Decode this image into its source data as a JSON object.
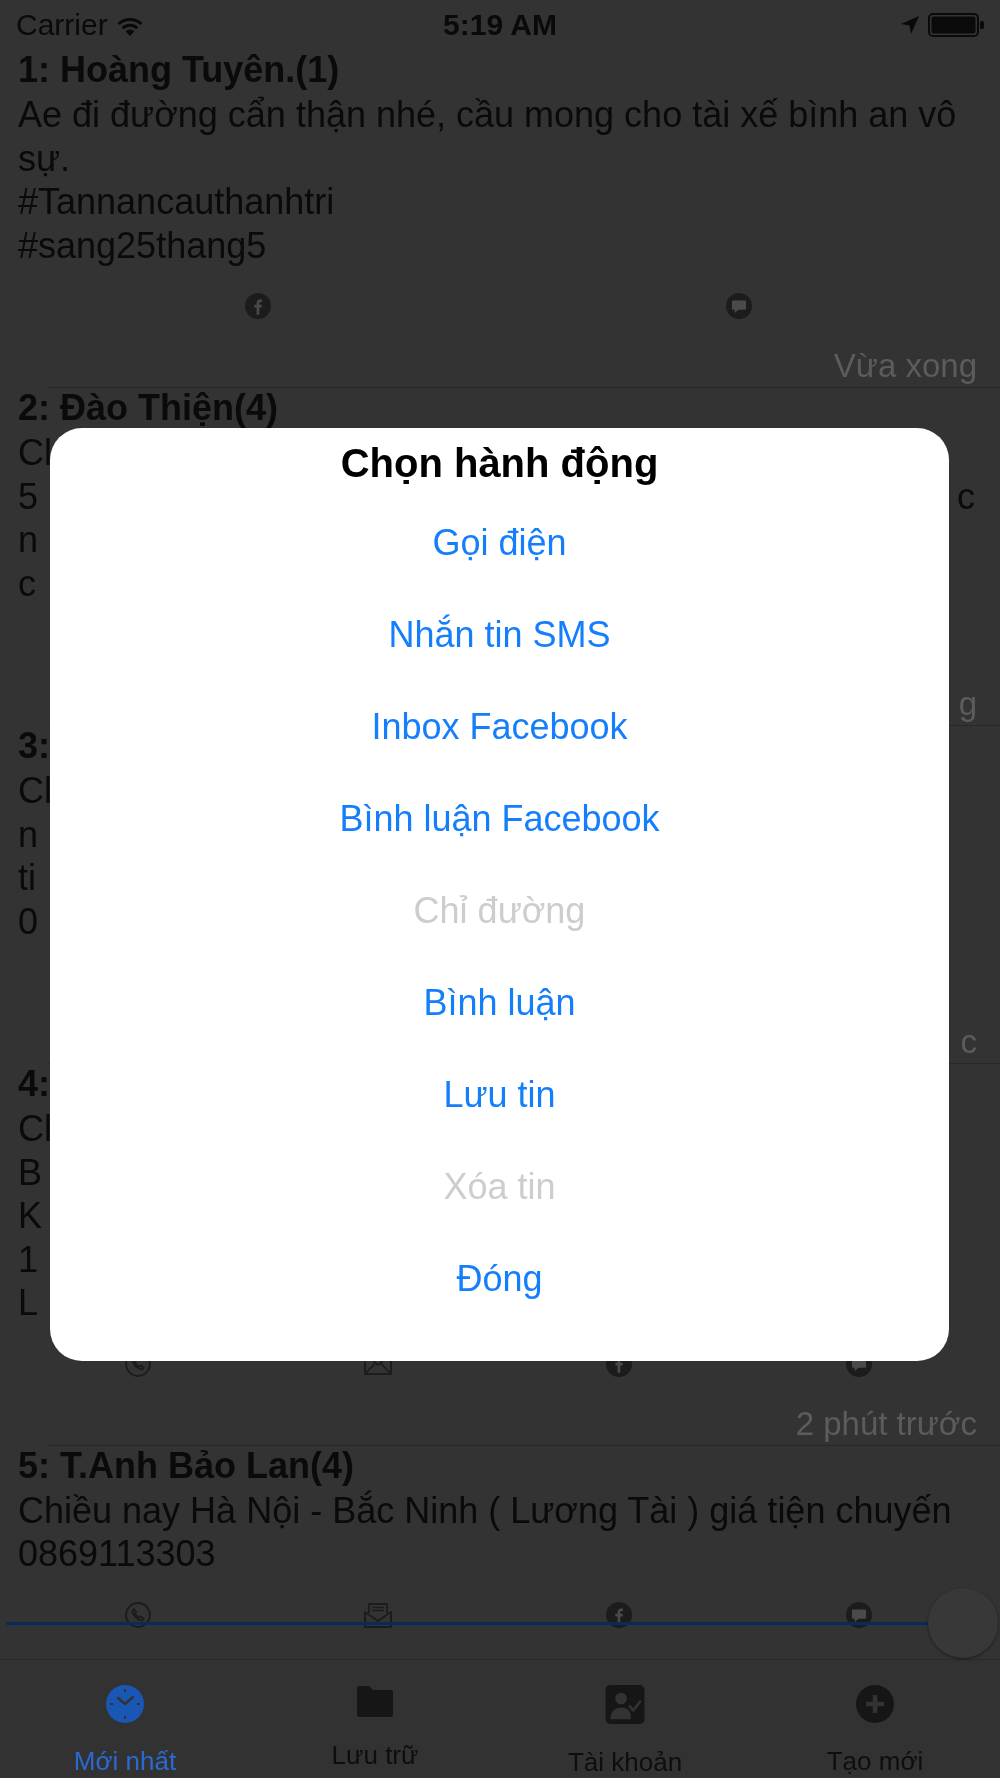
{
  "status_bar": {
    "carrier": "Carrier",
    "time": "5:19 AM"
  },
  "posts": [
    {
      "title": "1: Hoàng Tuyên.(1)",
      "lines": [
        {
          "text": "Ae đi đường cẩn thận nhé, cầu mong cho tài xế bình an vô"
        },
        {
          "text": "sự."
        },
        {
          "text": "#Tannancauthanhtri"
        },
        {
          "text": "#sang25thang5"
        }
      ],
      "actions": [
        {
          "kind": "facebook"
        },
        {
          "kind": "comment"
        }
      ],
      "time": "Vừa xong"
    },
    {
      "title": "2: Đào Thiện(4)",
      "lines": [
        {
          "text": "Cl"
        },
        {
          "text": "5",
          "right": "c"
        },
        {
          "text": "n"
        },
        {
          "text": "c"
        }
      ],
      "time": "g"
    },
    {
      "title": "3:",
      "lines": [
        {
          "text": "Cl"
        },
        {
          "text": "n"
        },
        {
          "text": "ti"
        },
        {
          "text": "0"
        }
      ],
      "time": "c"
    },
    {
      "title": "4:",
      "lines": [
        {
          "text": "Cl"
        },
        {
          "text": "B"
        },
        {
          "text": "K"
        },
        {
          "text": "1"
        },
        {
          "text": "L"
        }
      ],
      "actions": [
        {
          "kind": "phone"
        },
        {
          "kind": "envelope"
        },
        {
          "kind": "facebook"
        },
        {
          "kind": "comment"
        }
      ],
      "time": "2 phút trước"
    },
    {
      "title": "5: T.Anh Bảo Lan(4)",
      "lines": [
        {
          "text": "Chiều nay Hà Nội - Bắc Ninh ( Lương Tài ) giá tiện chuyến"
        },
        {
          "text": "0869113303"
        }
      ],
      "actions": [
        {
          "kind": "phone"
        },
        {
          "kind": "letter"
        },
        {
          "kind": "facebook"
        },
        {
          "kind": "comment"
        }
      ]
    }
  ],
  "tabs": [
    {
      "label": "Mới nhất",
      "kind": "clock",
      "selected": true
    },
    {
      "label": "Lưu trữ",
      "kind": "folder",
      "selected": false
    },
    {
      "label": "Tài khoản",
      "kind": "account",
      "selected": false
    },
    {
      "label": "Tạo mới",
      "kind": "plus",
      "selected": false
    }
  ],
  "dialog": {
    "title": "Chọn hành động",
    "items": [
      {
        "label": "Gọi điện",
        "disabled": false
      },
      {
        "label": "Nhắn tin SMS",
        "disabled": false
      },
      {
        "label": "Inbox Facebook",
        "disabled": false
      },
      {
        "label": "Bình luận Facebook",
        "disabled": false
      },
      {
        "label": "Chỉ đường",
        "disabled": true
      },
      {
        "label": "Bình luận",
        "disabled": false
      },
      {
        "label": "Lưu tin",
        "disabled": false
      },
      {
        "label": "Xóa tin",
        "disabled": true
      },
      {
        "label": "Đóng",
        "disabled": false
      }
    ]
  }
}
